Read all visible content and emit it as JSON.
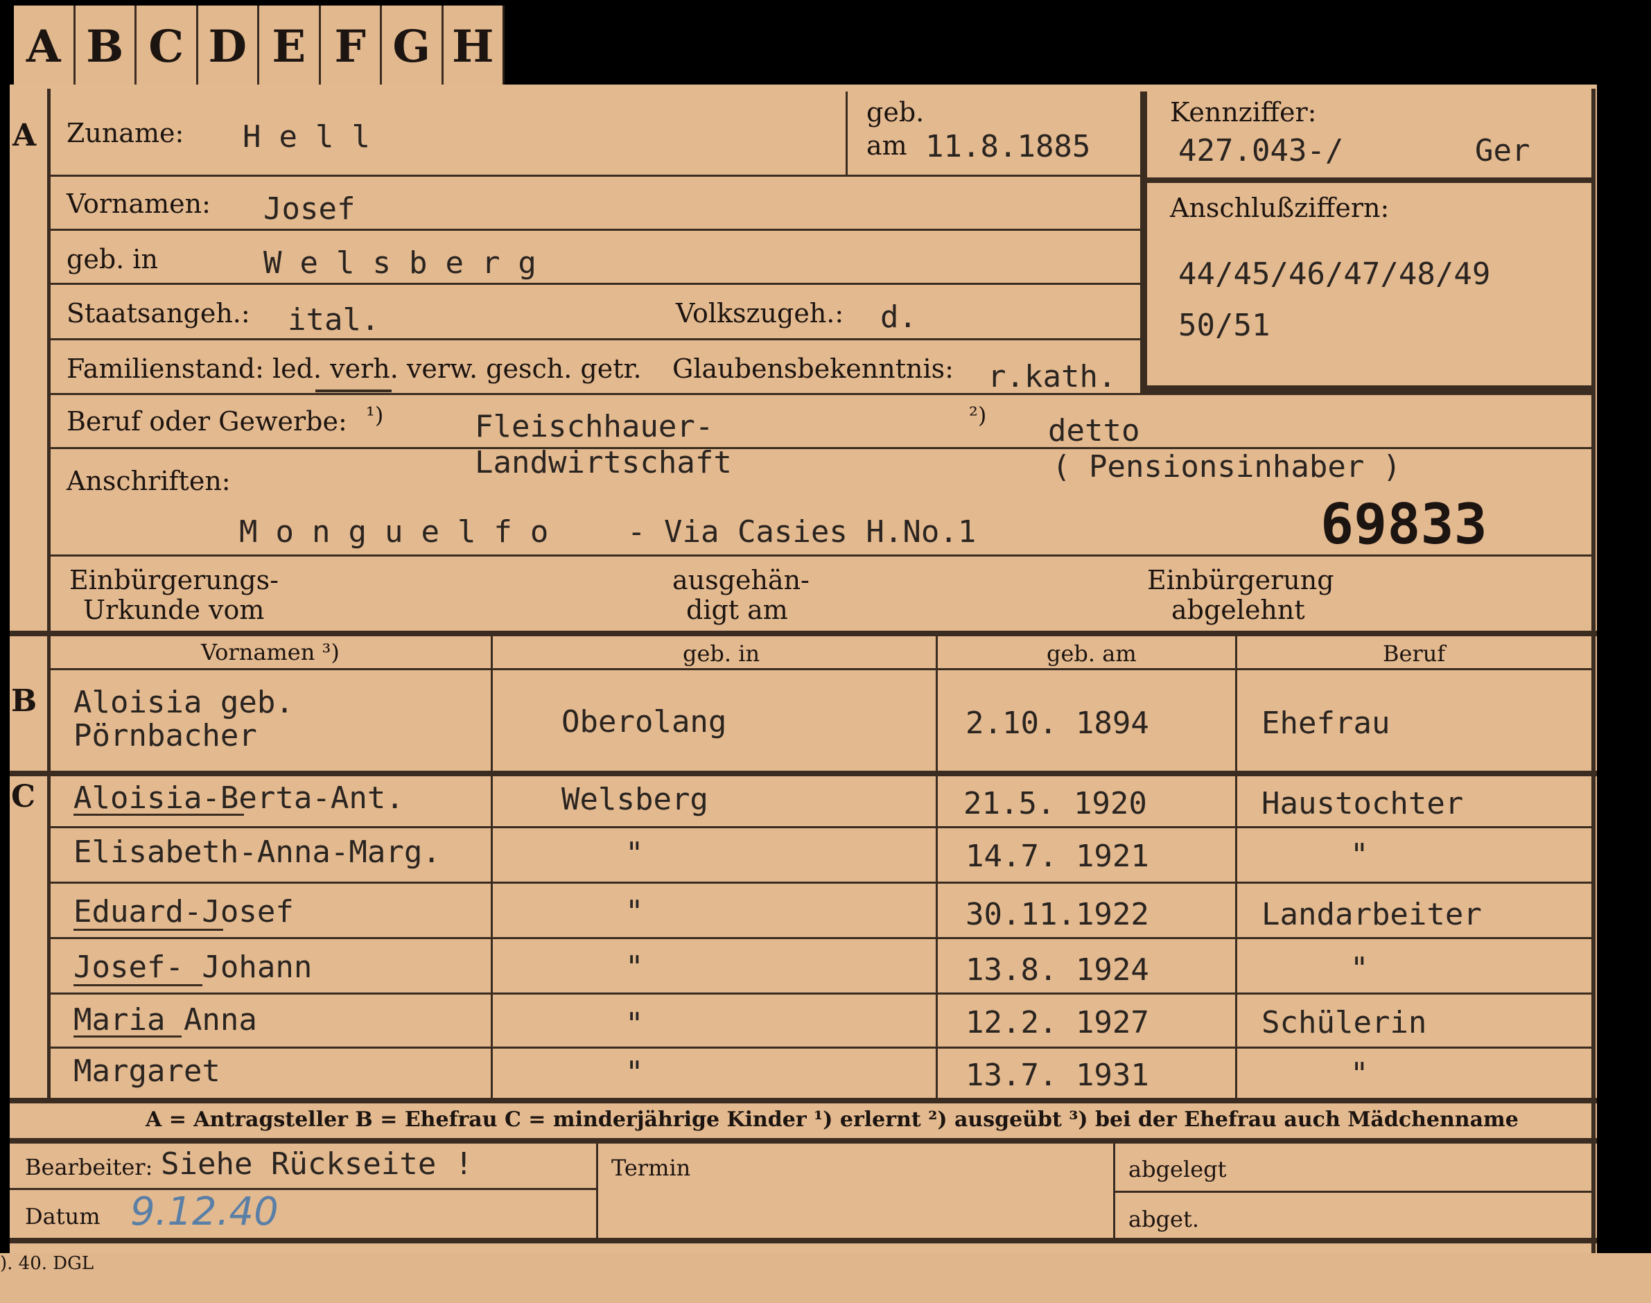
{
  "tabs": [
    "A",
    "B",
    "C",
    "D",
    "E",
    "F",
    "G",
    "H"
  ],
  "header": {
    "zuname_label": "Zuname:",
    "zuname": "Hell",
    "geb_label": "geb.",
    "am_label": "am",
    "geb_am": "11.8.1885",
    "kennziffer_label": "Kennziffer:",
    "kennziffer": "427.043-/",
    "kennziffer_suffix": "Ger",
    "vornamen_label": "Vornamen:",
    "vornamen": "Josef",
    "anschluss_label": "Anschlußziffern:",
    "anschluss_line1": "44/45/46/47/48/49",
    "anschluss_line2": "50/51",
    "gebin_label": "geb. in",
    "gebin": "Welsberg",
    "staat_label": "Staatsangeh.:",
    "staat": "ital.",
    "volk_label": "Volkszugeh.:",
    "volk": "d.",
    "familienstand_label": "Familienstand: led. verh. verw. gesch. getr.",
    "glauben_label": "Glaubensbekenntnis:",
    "glauben": "r.kath.",
    "beruf_label": "Beruf oder Gewerbe:",
    "fn1": "¹)",
    "fn2": "²)",
    "beruf1_line1": "Fleischhauer-",
    "beruf1_line2": "Landwirtschaft",
    "beruf2_line1": "detto",
    "beruf2_line2": "( Pensionsinhaber )",
    "anschriften_label": "Anschriften:",
    "adresse_town": "Monguelfo",
    "adresse_rest": "- Via Casies H.No.1",
    "number": "69833",
    "einb_label_1": "Einbürgerungs-",
    "einb_label_2": "Urkunde vom",
    "ausgeh_label_1": "ausgehän-",
    "ausgeh_label_2": "digt am",
    "abgel_label_1": "Einbürgerung",
    "abgel_label_2": "abgelehnt"
  },
  "table": {
    "columns": [
      "Vornamen ³)",
      "geb. in",
      "geb. am",
      "Beruf"
    ],
    "section_b": "B",
    "section_c": "C",
    "section_a": "A",
    "wife": {
      "name_line1": "Aloisia geb.",
      "name_line2": "Pörnbacher",
      "gebin": "Oberolang",
      "gebam": "2.10. 1894",
      "beruf": "Ehefrau"
    },
    "children": [
      {
        "name": "Aloisia-Berta-Ant.",
        "gebin": "Welsberg",
        "gebam": "21.5. 1920",
        "beruf": "Haustochter"
      },
      {
        "name": "Elisabeth-Anna-Marg.",
        "gebin": "\"",
        "gebam": "14.7. 1921",
        "beruf": "\""
      },
      {
        "name": "Eduard-Josef",
        "gebin": "\"",
        "gebam": "30.11.1922",
        "beruf": "Landarbeiter"
      },
      {
        "name": "Josef- Johann",
        "gebin": "\"",
        "gebam": "13.8. 1924",
        "beruf": "\""
      },
      {
        "name": "Maria Anna",
        "gebin": "\"",
        "gebam": "12.2. 1927",
        "beruf": "Schülerin"
      },
      {
        "name": "Margaret",
        "gebin": "\"",
        "gebam": "13.7. 1931",
        "beruf": "\""
      }
    ]
  },
  "legend": "A = Antragsteller   B = Ehefrau   C = minderjährige Kinder   ¹) erlernt   ²) ausgeübt   ³) bei der Ehefrau auch Mädchenname",
  "footer": {
    "bearbeiter_label": "Bearbeiter:",
    "bearbeiter": "Siehe Rückseite !",
    "termin_label": "Termin",
    "abgelegt_label": "abgelegt",
    "datum_label": "Datum",
    "datum": "9.12.40",
    "abget_label": "abget.",
    "print_code": "). 40. DGL"
  }
}
